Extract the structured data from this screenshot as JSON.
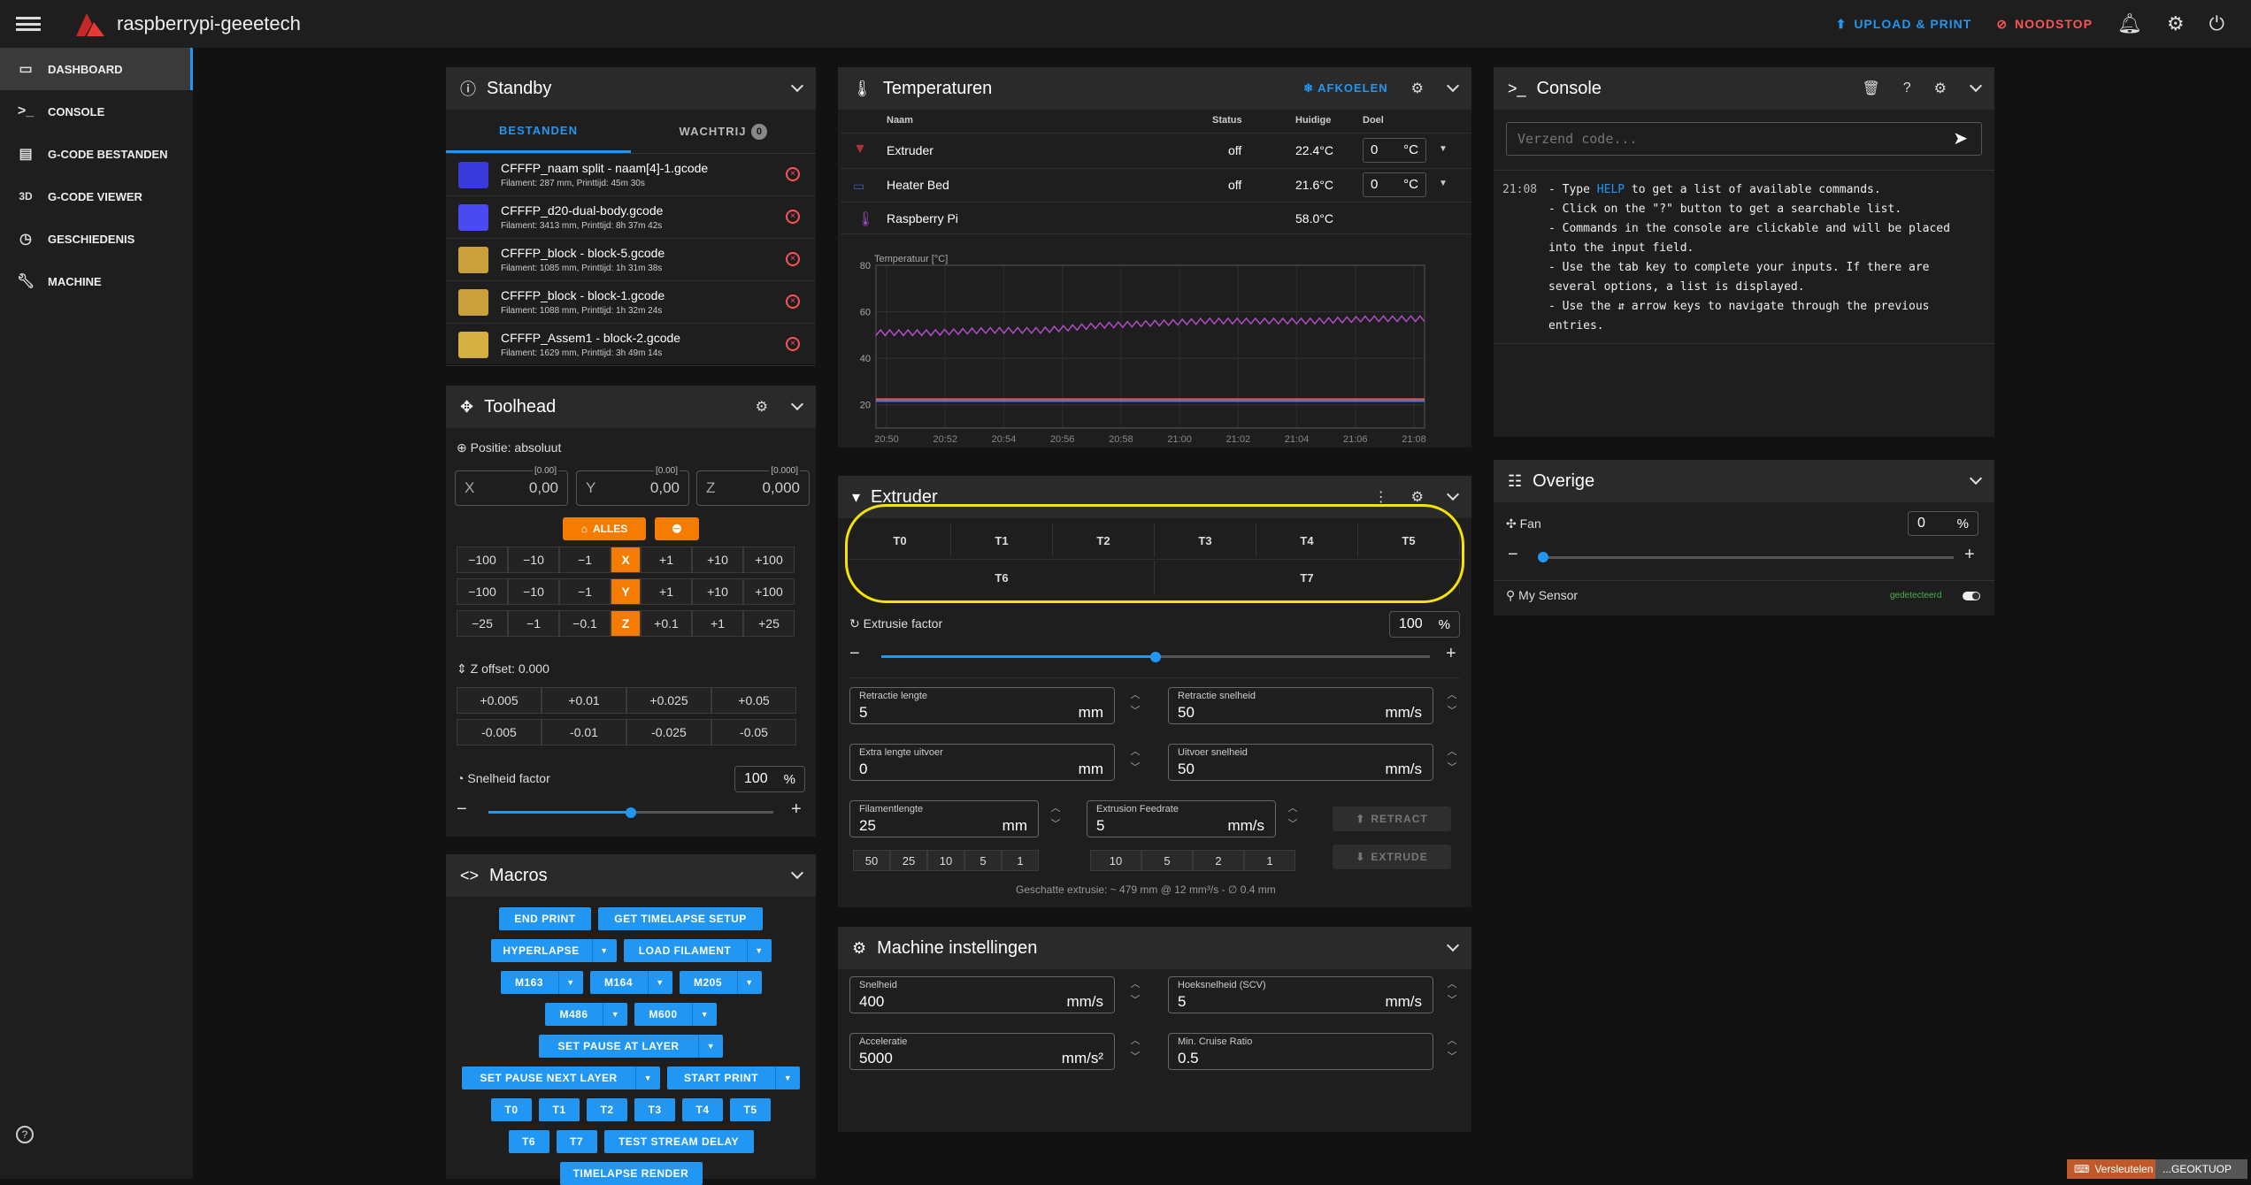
{
  "app": {
    "title": "raspberrypi-geeetech"
  },
  "topbar": {
    "upload_label": "UPLOAD & PRINT",
    "estop_label": "NOODSTOP"
  },
  "sidebar": {
    "items": [
      {
        "label": "DASHBOARD",
        "icon": "monitor-icon",
        "active": true
      },
      {
        "label": "CONSOLE",
        "icon": "console-icon"
      },
      {
        "label": "G-CODE BESTANDEN",
        "icon": "file-icon"
      },
      {
        "label": "G-CODE VIEWER",
        "icon": "3d-icon",
        "prefix": "3D"
      },
      {
        "label": "GESCHIEDENIS",
        "icon": "history-icon"
      },
      {
        "label": "MACHINE",
        "icon": "wrench-icon"
      }
    ]
  },
  "standby": {
    "title": "Standby",
    "tabs": [
      "BESTANDEN",
      "WACHTRIJ"
    ],
    "queue_count": "0",
    "files": [
      {
        "name": "CFFFP_naam split - naam[4]-1.gcode",
        "meta": "Filament: 287 mm, Printtijd: 45m 30s",
        "color": "#3a3adc"
      },
      {
        "name": "CFFFP_d20-dual-body.gcode",
        "meta": "Filament: 3413 mm, Printtijd: 8h 37m 42s",
        "color": "#4a4af0"
      },
      {
        "name": "CFFFP_block - block-5.gcode",
        "meta": "Filament: 1085 mm, Printtijd: 1h 31m 38s",
        "color": "#c9a03a"
      },
      {
        "name": "CFFFP_block - block-1.gcode",
        "meta": "Filament: 1088 mm, Printtijd: 1h 32m 24s",
        "color": "#c9a03a"
      },
      {
        "name": "CFFFP_Assem1 - block-2.gcode",
        "meta": "Filament: 1629 mm, Printtijd: 3h 49m 14s",
        "color": "#d4b040"
      }
    ]
  },
  "toolhead": {
    "title": "Toolhead",
    "position_label": "Positie: absoluut",
    "x": {
      "label": "X",
      "value": "0,00",
      "top": "[0.00]"
    },
    "y": {
      "label": "Y",
      "value": "0,00",
      "top": "[0.00]"
    },
    "z": {
      "label": "Z",
      "value": "0,000",
      "top": "[0.000]"
    },
    "home_all": "ALLES",
    "jog_x": [
      "−100",
      "−10",
      "−1",
      "X",
      "+1",
      "+10",
      "+100"
    ],
    "jog_y": [
      "−100",
      "−10",
      "−1",
      "Y",
      "+1",
      "+10",
      "+100"
    ],
    "jog_z": [
      "−25",
      "−1",
      "−0.1",
      "Z",
      "+0.1",
      "+1",
      "+25"
    ],
    "z_offset_label": "Z offset: 0.000",
    "zoff_up": [
      "+0.005",
      "+0.01",
      "+0.025",
      "+0.05"
    ],
    "zoff_down": [
      "-0.005",
      "-0.01",
      "-0.025",
      "-0.05"
    ],
    "speed_label": "Snelheid factor",
    "speed_value": "100",
    "speed_unit": "%",
    "speed_fraction": 0.5
  },
  "macros": {
    "title": "Macros",
    "rows": [
      [
        {
          "label": "END PRINT"
        },
        {
          "label": "GET TIMELAPSE SETUP"
        }
      ],
      [
        {
          "label": "HYPERLAPSE",
          "dd": true
        },
        {
          "label": "LOAD FILAMENT",
          "dd": true
        }
      ],
      [
        {
          "label": "M163",
          "dd": true
        },
        {
          "label": "M164",
          "dd": true
        },
        {
          "label": "M205",
          "dd": true
        }
      ],
      [
        {
          "label": "M486",
          "dd": true
        },
        {
          "label": "M600",
          "dd": true
        }
      ],
      [
        {
          "label": "SET PAUSE AT LAYER",
          "dd": true
        }
      ],
      [
        {
          "label": "SET PAUSE NEXT LAYER",
          "dd": true
        },
        {
          "label": "START PRINT",
          "dd": true
        }
      ],
      [
        {
          "label": "T0"
        },
        {
          "label": "T1"
        },
        {
          "label": "T2"
        },
        {
          "label": "T3"
        },
        {
          "label": "T4"
        },
        {
          "label": "T5"
        }
      ],
      [
        {
          "label": "T6"
        },
        {
          "label": "T7"
        },
        {
          "label": "TEST STREAM DELAY"
        }
      ],
      [
        {
          "label": "TIMELAPSE RENDER"
        }
      ]
    ]
  },
  "temperatures": {
    "title": "Temperaturen",
    "cooldown": "AFKOELEN",
    "headers": {
      "name": "Naam",
      "status": "Status",
      "current": "Huidige",
      "target": "Doel"
    },
    "rows": [
      {
        "name": "Extruder",
        "status": "off",
        "current": "22.4°C",
        "target": "0",
        "unit": "°C"
      },
      {
        "name": "Heater Bed",
        "status": "off",
        "current": "21.6°C",
        "target": "0",
        "unit": "°C"
      },
      {
        "name": "Raspberry Pi",
        "status": "",
        "current": "58.0°C"
      }
    ],
    "chart_label": "Temperatuur [°C]"
  },
  "chart_data": {
    "type": "line",
    "title": "",
    "ylabel": "Temperatuur [°C]",
    "ylim": [
      10,
      80
    ],
    "yticks": [
      20,
      40,
      60,
      80
    ],
    "x": [
      "20:50",
      "20:52",
      "20:54",
      "20:56",
      "20:58",
      "21:00",
      "21:02",
      "21:04",
      "21:06",
      "21:08"
    ],
    "series": [
      {
        "color": "#b04dc8",
        "values": [
          51,
          51,
          52,
          52,
          54,
          55,
          56,
          56,
          56,
          57,
          57
        ]
      },
      {
        "color": "#e05555",
        "values": [
          22.4,
          22.4,
          22.4,
          22.4,
          22.4,
          22.4,
          22.4,
          22.4,
          22.4,
          22.4,
          22.4
        ]
      },
      {
        "color": "#4a7bd8",
        "values": [
          21.6,
          21.6,
          21.6,
          21.6,
          21.6,
          21.6,
          21.6,
          21.6,
          21.6,
          21.6,
          21.6
        ]
      }
    ]
  },
  "extruder": {
    "title": "Extruder",
    "tools_row1": [
      "T0",
      "T1",
      "T2",
      "T3",
      "T4",
      "T5"
    ],
    "tools_row2": [
      "T6",
      "T7"
    ],
    "factor_label": "Extrusie factor",
    "factor_value": "100",
    "factor_unit": "%",
    "factor_fraction": 0.5,
    "retract_len": {
      "label": "Retractie lengte",
      "value": "5",
      "unit": "mm"
    },
    "retract_speed": {
      "label": "Retractie snelheid",
      "value": "50",
      "unit": "mm/s"
    },
    "extra_len": {
      "label": "Extra lengte uitvoer",
      "value": "0",
      "unit": "mm"
    },
    "unretract_speed": {
      "label": "Uitvoer snelheid",
      "value": "50",
      "unit": "mm/s"
    },
    "filament_len": {
      "label": "Filamentlengte",
      "value": "25",
      "unit": "mm"
    },
    "feedrate": {
      "label": "Extrusion Feedrate",
      "value": "5",
      "unit": "mm/s"
    },
    "len_chips": [
      "50",
      "25",
      "10",
      "5",
      "1"
    ],
    "rate_chips": [
      "10",
      "5",
      "2",
      "1"
    ],
    "retract_btn": "RETRACT",
    "extrude_btn": "EXTRUDE",
    "estimate": "Geschatte extrusie: ~ 479 mm @ 12 mm³/s - ∅ 0.4 mm"
  },
  "machine": {
    "title": "Machine instellingen",
    "speed": {
      "label": "Snelheid",
      "value": "400",
      "unit": "mm/s"
    },
    "scv": {
      "label": "Hoeksnelheid (SCV)",
      "value": "5",
      "unit": "mm/s"
    },
    "accel": {
      "label": "Acceleratie",
      "value": "5000",
      "unit": "mm/s²"
    },
    "cruise": {
      "label": "Min. Cruise Ratio",
      "value": "0.5",
      "unit": ""
    }
  },
  "console": {
    "title": "Console",
    "placeholder": "Verzend code...",
    "time": "21:08",
    "lines": [
      "- Type HELP to get a list of available commands.",
      "- Click on the \"?\" button to get a searchable list.",
      "- Commands in the console are clickable and will be placed",
      "into the input field.",
      "- Use the tab key to complete your inputs. If there are",
      "several options, a list is displayed.",
      "- Use the ⇵ arrow keys to navigate through the previous",
      "entries."
    ]
  },
  "overige": {
    "title": "Overige",
    "fan_label": "Fan",
    "fan_value": "0",
    "fan_unit": "%",
    "fan_fraction": 0,
    "sensor_label": "My Sensor",
    "sensor_status": "gedetecteerd"
  },
  "taskbar": {
    "a": "Versleutelen",
    "b": "...GEOKTUOP"
  },
  "colors": {
    "accent": "#2196f3",
    "orange": "#f57c00",
    "danger": "#ff5252",
    "highlight": "#f5e400",
    "ok": "#4caf50"
  }
}
